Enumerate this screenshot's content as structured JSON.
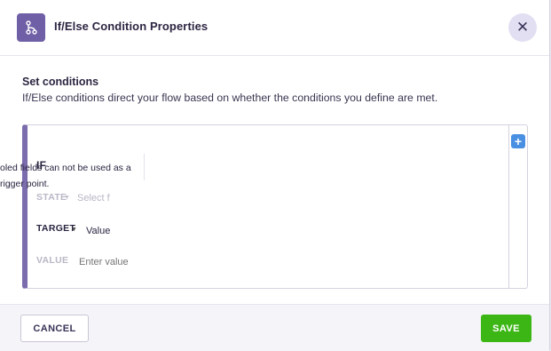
{
  "dialog": {
    "title": "If/Else Condition Properties",
    "header_icon": "flow-branch-icon",
    "close_glyph": "✕"
  },
  "section": {
    "title": "Set conditions",
    "description": "If/Else conditions direct your flow based on whether the conditions you define are met."
  },
  "condition": {
    "add_glyph": "+",
    "if_label": "IF",
    "state_label": "STATE",
    "state_placeholder": "Select f",
    "target_label": "TARGET",
    "target_value": "Value",
    "value_label": "VALUE",
    "value_placeholder": "Enter value",
    "tooltip_line1": "oled fields can not be used as a",
    "tooltip_line2": "rigger point."
  },
  "footer": {
    "cancel_label": "CANCEL",
    "save_label": "SAVE"
  },
  "colors": {
    "accent": "#7b6cae",
    "save": "#3cb615",
    "add": "#4a90e2"
  }
}
